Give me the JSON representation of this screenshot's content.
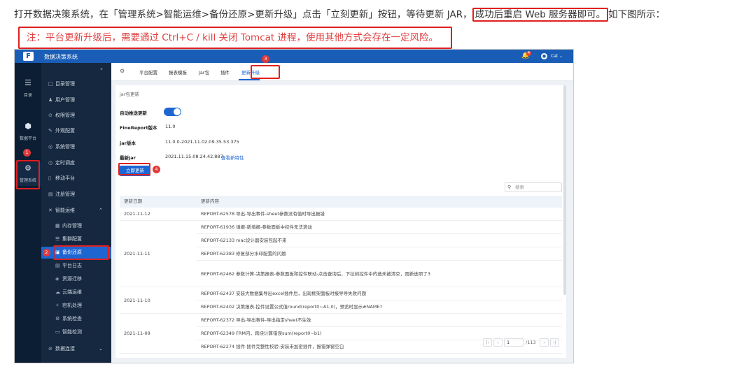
{
  "doc": {
    "line1_a": "打开数据决策系统，在「管理系统>智能运维>备份还原>更新升级」点击「立刻更新」按钮，等待更新 JAR，",
    "line1_b": "成功后重启 Web 服务器即可。",
    "line1_c": "如下图所示：",
    "note": "注：平台更新升级后，需要通过 Ctrl+C / kill 关闭 Tomcat 进程，使用其他方式会存在一定风险。"
  },
  "app": {
    "logo_char": "F",
    "title": "数据决策系统",
    "bell_count": "4",
    "user": "Cat"
  },
  "rail": [
    {
      "label": "目录",
      "icon": "list-icon"
    },
    {
      "label": "数据平台",
      "icon": "cube-icon"
    },
    {
      "label": "管理系统",
      "icon": "gear-icon"
    }
  ],
  "menu": {
    "items": [
      {
        "label": "目录管理",
        "icon": "□"
      },
      {
        "label": "用户管理",
        "icon": "♟"
      },
      {
        "label": "权限管理",
        "icon": "⊙"
      },
      {
        "label": "外观配置",
        "icon": "✎"
      },
      {
        "label": "系统管理",
        "icon": "◎"
      },
      {
        "label": "定时调度",
        "icon": "◷"
      },
      {
        "label": "移动平台",
        "icon": "▯"
      },
      {
        "label": "注册管理",
        "icon": "▤"
      },
      {
        "label": "智能运维",
        "icon": "✕"
      },
      {
        "label": "内存管理",
        "icon": "▦"
      },
      {
        "label": "集群配置",
        "icon": "☰"
      },
      {
        "label": "备份还原",
        "icon": "▣"
      },
      {
        "label": "平台日志",
        "icon": "▤"
      },
      {
        "label": "资源迁移",
        "icon": "◈"
      },
      {
        "label": "云端运维",
        "icon": "☁"
      },
      {
        "label": "宕机处理",
        "icon": "✧"
      },
      {
        "label": "系统检查",
        "icon": "⚙"
      },
      {
        "label": "智能检测",
        "icon": "▭"
      },
      {
        "label": "数据连接",
        "icon": "⊘"
      }
    ]
  },
  "tabs": [
    "平台配置",
    "报表模板",
    "Jar包",
    "插件",
    "更新升级"
  ],
  "panel": {
    "section_title": "jar包更新",
    "auto_label": "自动推送更新",
    "version_label": "FineReport版本",
    "version_value": "11.0",
    "jar_label": "jar版本",
    "jar_value": "11.0.0-2021.11.02.09.35.53.375",
    "latest_label": "最新jar",
    "latest_value": "2021.11.15.08.24.42.887",
    "details_link": "查看新特性",
    "update_button": "立即更新",
    "search_placeholder": "搜索"
  },
  "table": {
    "headers": [
      "更新日期",
      "更新内容"
    ],
    "groups": [
      {
        "date": "2021-11-12",
        "items": [
          "REPORT-62578 导出-导出事件-sheet参数没有值时导出报错"
        ]
      },
      {
        "date": "2021-11-11",
        "items": [
          "REPORT-61936 填报-新填报-参数面板中控件无法滚动",
          "REPORT-62133 mac设计器安装包起不来",
          "REPORT-62383 修复部分水印配置的问题",
          "REPORT-62462 参数计算-决策报表-参数面板和控件联动-点击查询后，下拉树控件中的选未被清空，而新选项了3"
        ]
      },
      {
        "date": "2021-11-10",
        "items": [
          "REPORT-62437 安装大数据集导出excel插件后，出现框架面板时报导导失败问题",
          "REPORT-62402 决策报表-控件设置公式值round(report0~A1,0)，预览时显示#NAME?"
        ]
      },
      {
        "date": "2021-11-09",
        "items": [
          "REPORT-62372 导出-导出事件-导出指定sheet不生效",
          "REPORT-62349 FRM内，跨块计算错误sum(report0~b1)",
          "REPORT-62274 插件-插件完整性校验-安装未加密插件，报错弹窗空白"
        ]
      }
    ]
  },
  "pager": {
    "page": "1",
    "total": "/113"
  },
  "markers": [
    "1",
    "2",
    "3",
    "4"
  ]
}
